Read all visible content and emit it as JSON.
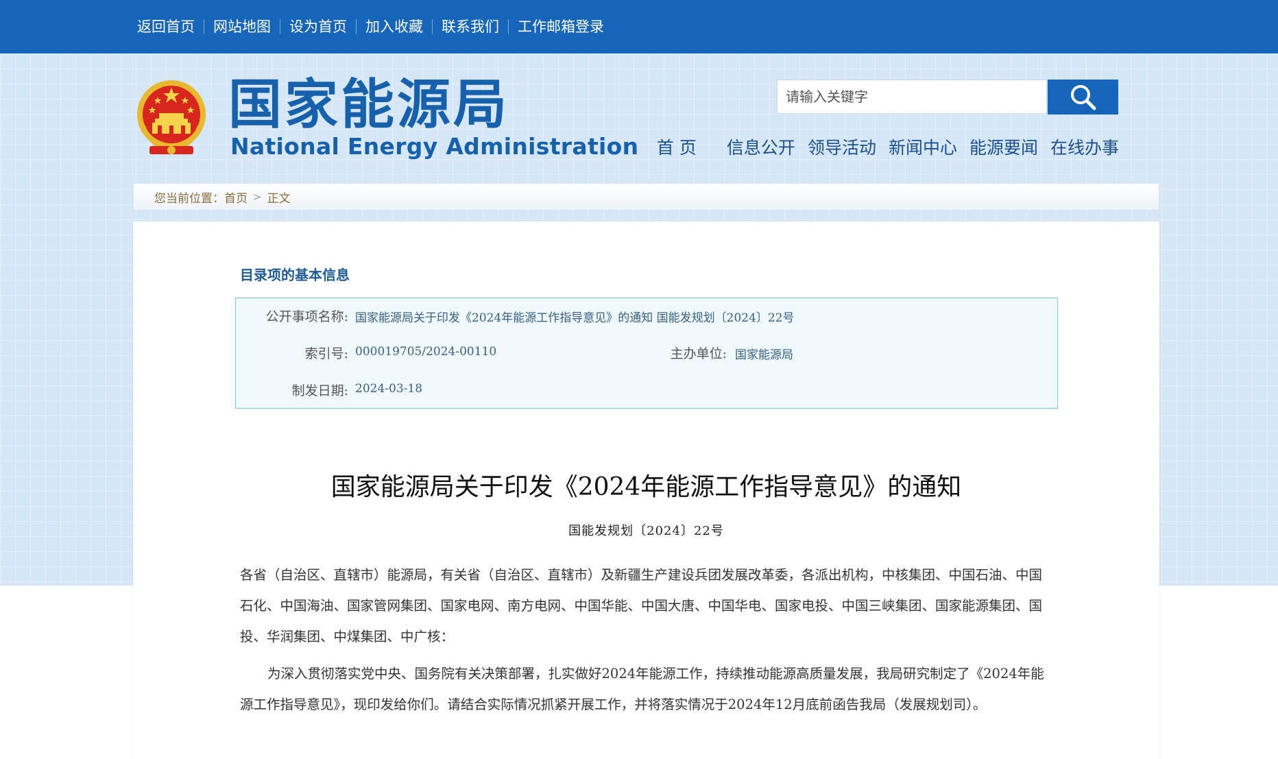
{
  "topbar": {
    "links": [
      "返回首页",
      "网站地图",
      "设为首页",
      "加入收藏",
      "联系我们",
      "工作邮箱登录"
    ]
  },
  "header": {
    "logo_cn": "国家能源局",
    "logo_en": "National Energy Administration",
    "search_placeholder": "请输入关键字",
    "nav": [
      "首页",
      "信息公开",
      "领导活动",
      "新闻中心",
      "能源要闻",
      "在线办事"
    ]
  },
  "breadcrumb": {
    "prefix": "您当前位置：",
    "home": "首页",
    "current": "正文"
  },
  "info": {
    "section_title": "目录项的基本信息",
    "name_label": "公开事项名称:",
    "name_value": "国家能源局关于印发《2024年能源工作指导意见》的通知 国能发规划〔2024〕22号",
    "index_label": "索引号:",
    "index_value": "000019705/2024-00110",
    "unit_label": "主办单位:",
    "unit_value": "国家能源局",
    "date_label": "制发日期:",
    "date_value": "2024-03-18"
  },
  "document": {
    "title": "国家能源局关于印发《2024年能源工作指导意见》的通知",
    "number": "国能发规划〔2024〕22号",
    "addressees": "各省（自治区、直辖市）能源局，有关省（自治区、直辖市）及新疆生产建设兵团发展改革委，各派出机构，中核集团、中国石油、中国石化、中国海油、国家管网集团、国家电网、南方电网、中国华能、中国大唐、中国华电、国家电投、中国三峡集团、国家能源集团、国投、华润集团、中煤集团、中广核：",
    "body": "为深入贯彻落实党中央、国务院有关决策部署，扎实做好2024年能源工作，持续推动能源高质量发展，我局研究制定了《2024年能源工作指导意见》，现印发给你们。请结合实际情况抓紧开展工作，并将落实情况于2024年12月底前函告我局（发展规划司）。"
  },
  "colors": {
    "topbar": "#1565b8",
    "brand": "#1761ac",
    "info_box_bg": "#eff9fc",
    "info_box_border": "#7fc6dc"
  }
}
